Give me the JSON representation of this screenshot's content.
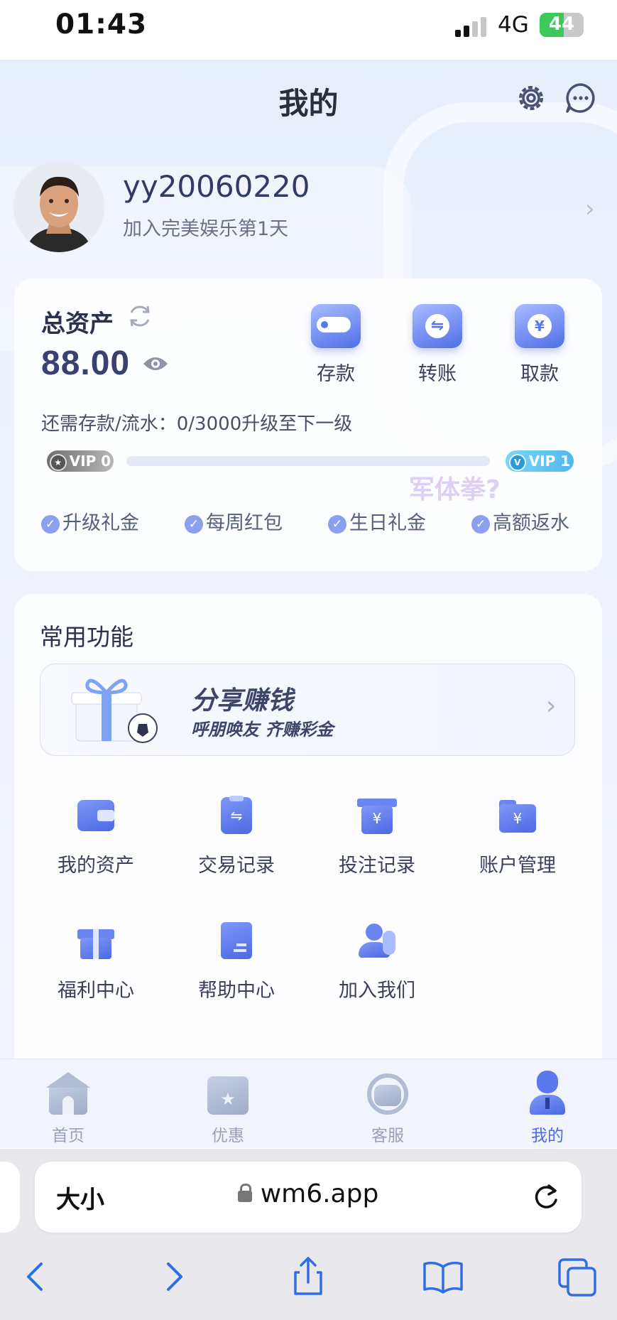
{
  "status_bar": {
    "time": "01:43",
    "network": "4G",
    "battery": "44"
  },
  "header": {
    "title": "我的",
    "settings_icon": "gear-icon",
    "message_icon": "chat-icon"
  },
  "profile": {
    "username": "yy20060220",
    "joined": "加入完美娱乐第1天"
  },
  "assets": {
    "label": "总资产",
    "balance": "88.00",
    "actions": [
      {
        "label": "存款",
        "icon": "wallet-icon"
      },
      {
        "label": "转账",
        "icon": "transfer-icon"
      },
      {
        "label": "取款",
        "icon": "withdraw-icon"
      }
    ],
    "progress_text": "还需存款/流水：0/3000升级至下一级",
    "progress_fraction": 0,
    "vip_current": "VIP 0",
    "vip_next": "VIP 1",
    "perks": [
      "升级礼金",
      "每周红包",
      "生日礼金",
      "高额返水"
    ]
  },
  "watermark": "军体拳?",
  "functions": {
    "title": "常用功能",
    "banner": {
      "title": "分享赚钱",
      "subtitle": "呼朋唤友 齐赚彩金"
    },
    "items": [
      {
        "label": "我的资产",
        "icon": "wallet-icon"
      },
      {
        "label": "交易记录",
        "icon": "clipboard-icon"
      },
      {
        "label": "投注记录",
        "icon": "bet-record-icon"
      },
      {
        "label": "账户管理",
        "icon": "folder-icon"
      },
      {
        "label": "福利中心",
        "icon": "gift-icon"
      },
      {
        "label": "帮助中心",
        "icon": "book-icon"
      },
      {
        "label": "加入我们",
        "icon": "users-icon"
      }
    ]
  },
  "tabbar": {
    "items": [
      {
        "label": "首页",
        "icon": "home-icon"
      },
      {
        "label": "优惠",
        "icon": "ticket-icon"
      },
      {
        "label": "客服",
        "icon": "headset-icon"
      },
      {
        "label": "我的",
        "icon": "user-icon"
      }
    ],
    "active": 3
  },
  "browser": {
    "text_size": "大小",
    "url": "wm6.app"
  },
  "colors": {
    "accent": "#4a6ae6",
    "icon_gradient_start": "#a9bcff",
    "icon_gradient_end": "#4f6ee9",
    "vip_next": "#4fb8ec"
  }
}
